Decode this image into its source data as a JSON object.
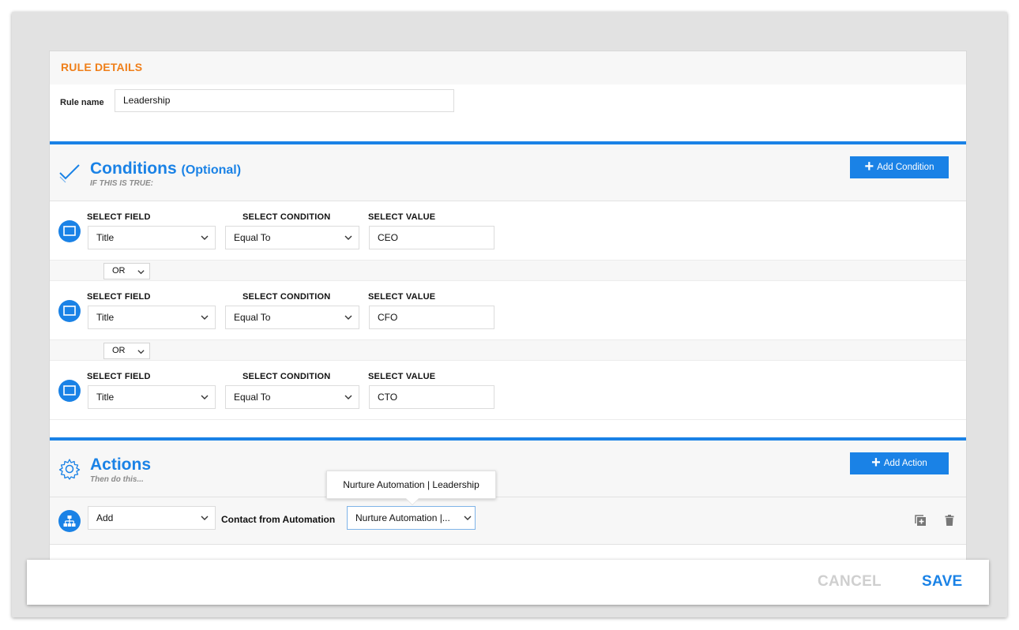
{
  "rule_details": {
    "title": "RULE DETAILS",
    "rule_name_label": "Rule name",
    "rule_name_value": "Leadership"
  },
  "conditions": {
    "title": "Conditions",
    "optional": "(Optional)",
    "subtitle": "IF THIS IS TRUE:",
    "add_button": "Add Condition",
    "labels": {
      "field": "SELECT FIELD",
      "condition": "SELECT CONDITION",
      "value": "SELECT VALUE"
    },
    "rows": [
      {
        "field": "Title",
        "condition": "Equal To",
        "value": "CEO"
      },
      {
        "field": "Title",
        "condition": "Equal To",
        "value": "CFO"
      },
      {
        "field": "Title",
        "condition": "Equal To",
        "value": "CTO"
      }
    ],
    "connectors": [
      "OR",
      "OR"
    ]
  },
  "actions": {
    "title": "Actions",
    "subtitle": "Then do this...",
    "add_button": "Add Action",
    "row": {
      "verb": "Add",
      "label": "Contact from Automation",
      "target": "Nurture Automation |...",
      "tooltip": "Nurture Automation | Leadership"
    }
  },
  "footer": {
    "cancel": "CANCEL",
    "save": "SAVE"
  },
  "colors": {
    "accent": "#1a82e6",
    "orange": "#ef7f1a",
    "muted": "#cfcfcf"
  },
  "icons": {
    "conditions": "checkmark-icon",
    "actions": "gear-icon",
    "row": "monitor-icon",
    "action_row": "hierarchy-icon",
    "duplicate": "duplicate-icon",
    "delete": "trash-icon",
    "dropdown": "chevron-down-icon"
  }
}
